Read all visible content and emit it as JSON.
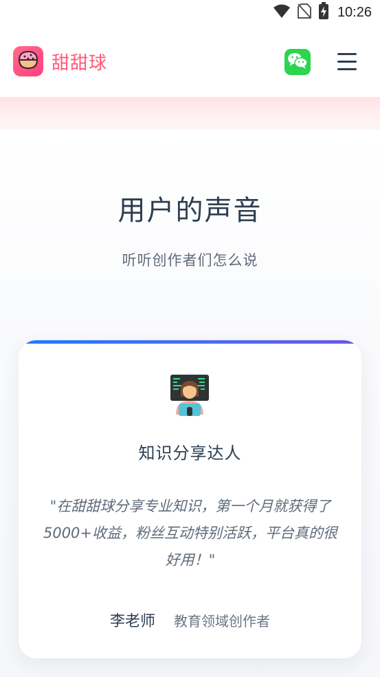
{
  "status_bar": {
    "time": "10:26",
    "icons": [
      "wifi-icon",
      "no-sim-icon",
      "battery-charging-icon"
    ]
  },
  "header": {
    "brand": "甜甜球",
    "logo_icon": "donut-icon",
    "wechat_icon": "wechat-icon",
    "menu_icon": "hamburger-menu-icon"
  },
  "section": {
    "title": "用户的声音",
    "subtitle": "听听创作者们怎么说"
  },
  "testimonial": {
    "emoji_icon": "technologist-emoji-icon",
    "title": "知识分享达人",
    "quote": "\"在甜甜球分享专业知识，第一个月就获得了5000+收益，粉丝互动特别活跃，平台真的很好用！\"",
    "author_name": "李老师",
    "author_role": "教育领域创作者"
  },
  "colors": {
    "brand": "#ff5a76",
    "wechat": "#2bd54d",
    "heading": "#2c3e50",
    "muted": "#5f6b7a",
    "card_accent_start": "#1f7bff",
    "card_accent_end": "#6c57e8"
  }
}
